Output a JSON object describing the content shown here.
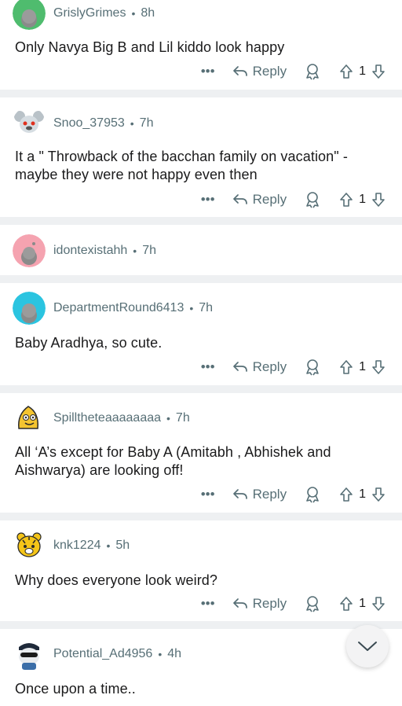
{
  "comments": [
    {
      "user": "GrislyGrimes",
      "time": "8h",
      "body": "Only Navya Big B and Lil kiddo look happy",
      "reply": "Reply",
      "votes": "1",
      "more": "•••",
      "avatar": "grey-snoo"
    },
    {
      "user": "Snoo_37953",
      "time": "7h",
      "body": "It a \" Throwback of the bacchan family on vacation\" - maybe they were not happy even then",
      "reply": "Reply",
      "votes": "1",
      "more": "•••",
      "avatar": "koala-snoo"
    },
    {
      "user": "idontexistahh",
      "time": "7h",
      "avatar": "pink-snoo"
    },
    {
      "user": "DepartmentRound6413",
      "time": "7h",
      "body": "Baby Aradhya, so cute.",
      "reply": "Reply",
      "votes": "1",
      "more": "•••",
      "avatar": "cyan-snoo"
    },
    {
      "user": "Spilltheteaaaaaaaa",
      "time": "7h",
      "body": "All ‘A’s except for Baby A (Amitabh , Abhishek and Aishwarya) are looking off!",
      "reply": "Reply",
      "votes": "1",
      "more": "•••",
      "avatar": "banana-snoo"
    },
    {
      "user": "knk1224",
      "time": "5h",
      "body": "Why does everyone look weird?",
      "reply": "Reply",
      "votes": "1",
      "more": "•••",
      "avatar": "tiger-snoo"
    },
    {
      "user": "Potential_Ad4956",
      "time": "4h",
      "body": "Once upon a time..",
      "avatar": "cap-snoo"
    }
  ],
  "separator": "•",
  "icons": {
    "more": "ellipsis-icon",
    "reply": "reply-arrow-icon",
    "award": "award-icon",
    "upvote": "upvote-arrow-icon",
    "downvote": "downvote-arrow-icon",
    "fab": "chevron-down-icon"
  }
}
